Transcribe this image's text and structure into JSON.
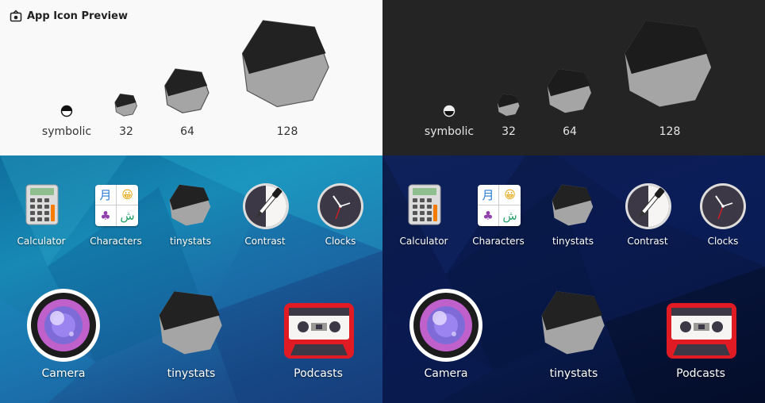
{
  "app": {
    "title": "App Icon Preview",
    "title_icon": "app-preview-icon"
  },
  "sizes": {
    "symbolic": "symbolic",
    "s32": "32",
    "s64": "64",
    "s128": "128"
  },
  "grid": {
    "small": [
      "Calculator",
      "Characters",
      "tinystats",
      "Contrast",
      "Clocks"
    ],
    "large": [
      "Camera",
      "tinystats",
      "Podcasts"
    ]
  },
  "characters_glyphs": [
    "月",
    "😀",
    "♣",
    "ش"
  ],
  "colors": {
    "light_bg": "#f9f9f9",
    "dark_bg": "#242424",
    "icon_dark": "#222222",
    "icon_light": "#a5a5a5",
    "blue_bg": "#1789b5",
    "navy_bg": "#0a1a50"
  }
}
